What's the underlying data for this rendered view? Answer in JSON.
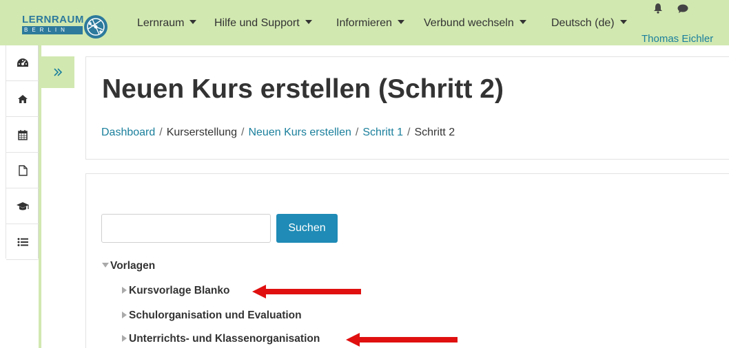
{
  "navbar": {
    "logo_text": "LERNRAUM",
    "logo_subtext": "BERLIN",
    "menu": [
      {
        "label": "Lernraum"
      },
      {
        "label": "Hilfe und Support"
      },
      {
        "label": "Informieren"
      },
      {
        "label": "Verbund wechseln"
      },
      {
        "label": "Deutsch (de)"
      }
    ],
    "user_name": "Thomas Eichler"
  },
  "sidebar": {
    "items": [
      {
        "icon": "dashboard-icon"
      },
      {
        "icon": "home-icon"
      },
      {
        "icon": "calendar-icon"
      },
      {
        "icon": "file-icon"
      },
      {
        "icon": "graduation-cap-icon"
      },
      {
        "icon": "list-icon"
      }
    ],
    "drawer_toggle_icon": "double-chevron-right-icon"
  },
  "header": {
    "title": "Neuen Kurs erstellen (Schritt 2)",
    "breadcrumb": [
      {
        "label": "Dashboard",
        "link": true
      },
      {
        "label": "Kurserstellung",
        "link": false
      },
      {
        "label": "Neuen Kurs erstellen",
        "link": true
      },
      {
        "label": "Schritt 1",
        "link": true
      },
      {
        "label": "Schritt 2",
        "link": false
      }
    ],
    "separator": "/"
  },
  "search": {
    "value": "",
    "button_label": "Suchen"
  },
  "tree": {
    "root_label": "Vorlagen",
    "children": [
      {
        "label": "Kursvorlage Blanko"
      },
      {
        "label": "Schulorganisation und Evaluation"
      },
      {
        "label": "Unterrichts- und Klassenorganisation"
      }
    ]
  },
  "colors": {
    "navbar_bg": "#d1e8b0",
    "link": "#1a7f9c",
    "button": "#1f8bb6",
    "annotation_arrow": "#e01010"
  }
}
